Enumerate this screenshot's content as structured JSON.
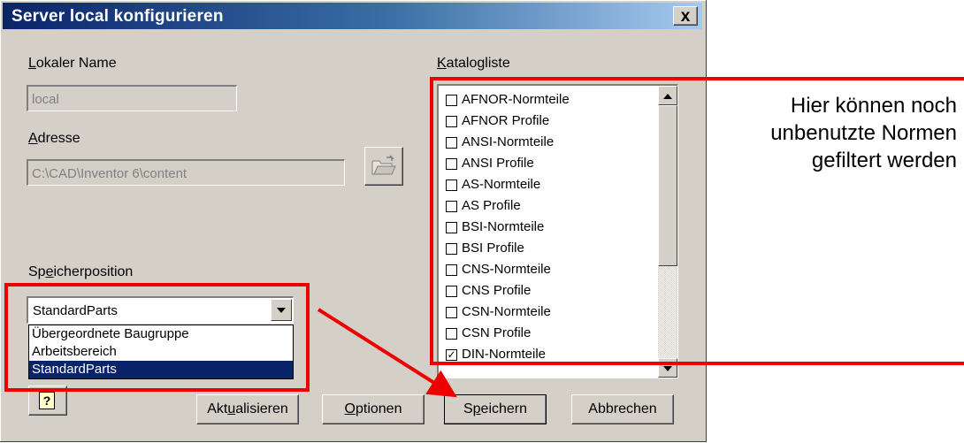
{
  "dialog": {
    "title": "Server local konfigurieren",
    "close_label": "x"
  },
  "local_name": {
    "label_ul": "L",
    "label_rest": "okaler Name",
    "value": "local"
  },
  "address": {
    "label_ul": "A",
    "label_rest": "dresse",
    "value": "C:\\CAD\\Inventor 6\\content",
    "browse_icon": "folder-open-icon"
  },
  "storage": {
    "label_pre": "Sp",
    "label_ul": "e",
    "label_rest": "icherposition",
    "selected": "StandardParts",
    "options": [
      "Übergeordnete Baugruppe",
      "Arbeitsbereich",
      "StandardParts"
    ]
  },
  "catalog": {
    "label_ul": "K",
    "label_rest": "atalogliste",
    "items": [
      {
        "label": "AFNOR-Normteile",
        "checked": false
      },
      {
        "label": "AFNOR Profile",
        "checked": false
      },
      {
        "label": "ANSI-Normteile",
        "checked": false
      },
      {
        "label": "ANSI Profile",
        "checked": false
      },
      {
        "label": "AS-Normteile",
        "checked": false
      },
      {
        "label": "AS Profile",
        "checked": false
      },
      {
        "label": "BSI-Normteile",
        "checked": false
      },
      {
        "label": "BSI Profile",
        "checked": false
      },
      {
        "label": "CNS-Normteile",
        "checked": false
      },
      {
        "label": "CNS Profile",
        "checked": false
      },
      {
        "label": "CSN-Normteile",
        "checked": false
      },
      {
        "label": "CSN Profile",
        "checked": false
      },
      {
        "label": "DIN-Normteile",
        "checked": true
      }
    ]
  },
  "buttons": {
    "help_icon": "help-icon",
    "update_pre": "Akt",
    "update_ul": "u",
    "update_rest": "alisieren",
    "options_ul": "O",
    "options_rest": "ptionen",
    "save_pre": "S",
    "save_ul": "p",
    "save_rest": "eichern",
    "cancel": "Abbrechen"
  },
  "annotation": {
    "lines": [
      "Hier können noch",
      "unbenutzte Normen",
      "gefiltert werden"
    ],
    "color": "#ee0000"
  }
}
